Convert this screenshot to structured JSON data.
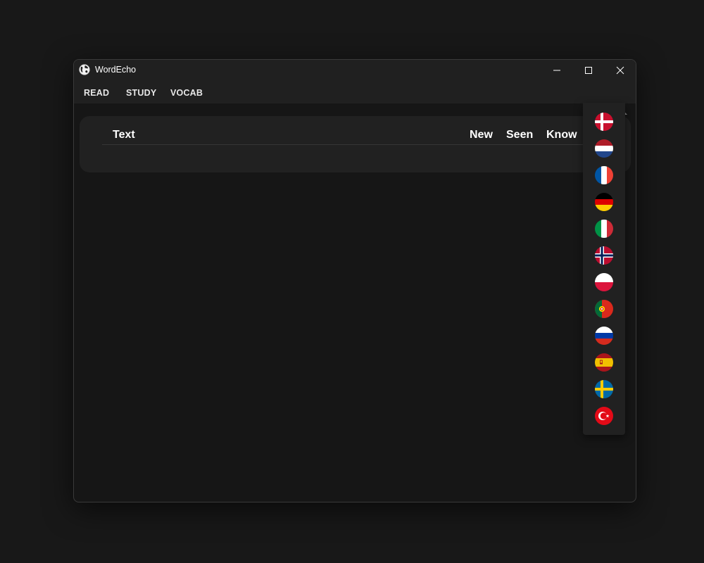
{
  "window": {
    "title": "WordEcho",
    "icon": "globe-icon",
    "controls": [
      "minimize-icon",
      "maximize-icon",
      "close-icon"
    ]
  },
  "menu": {
    "items": [
      {
        "label": "READ"
      },
      {
        "label": "STUDY"
      },
      {
        "label": "VOCAB"
      }
    ]
  },
  "language_selector": {
    "current": "turkey-flag-icon",
    "open": true,
    "options": [
      "denmark-flag-icon",
      "netherlands-flag-icon",
      "france-flag-icon",
      "germany-flag-icon",
      "italy-flag-icon",
      "norway-flag-icon",
      "poland-flag-icon",
      "portugal-flag-icon",
      "russia-flag-icon",
      "spain-flag-icon",
      "sweden-flag-icon",
      "turkey-flag-icon"
    ]
  },
  "table": {
    "columns": [
      "Text",
      "New",
      "Seen",
      "Know"
    ],
    "rows": []
  },
  "colors": {
    "background": "#161616",
    "titlebar": "#202020",
    "card": "#212121",
    "text": "#ffffff"
  }
}
